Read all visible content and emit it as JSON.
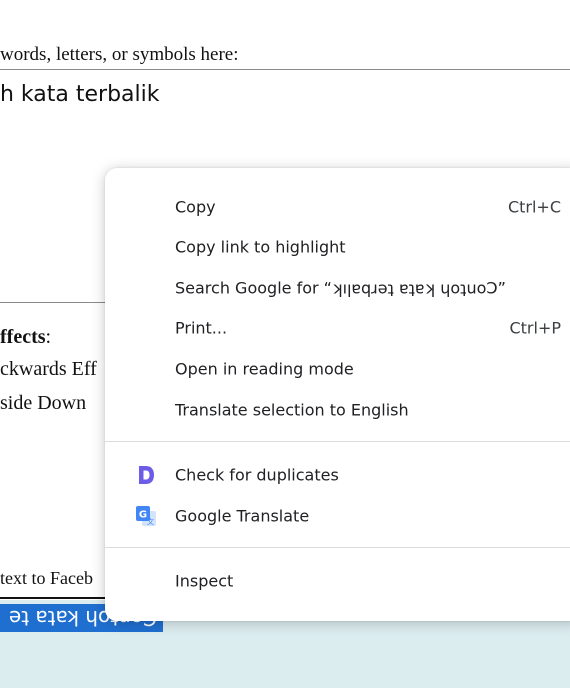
{
  "page": {
    "prompt": "words, letters, or symbols here:",
    "textarea_value": "h kata terbalik",
    "effects_title": "ffects",
    "effects_colon": ":",
    "effects": [
      "ckwards Eff",
      "side Down "
    ],
    "facebook_text": "text to Faceb",
    "selected_output": "Contoh kata te"
  },
  "context_menu": {
    "copy": {
      "label": "Copy",
      "shortcut": "Ctrl+C"
    },
    "copy_link": {
      "label": "Copy link to highlight"
    },
    "search": {
      "label": "Search Google for “ʞıןɐqɹǝʇ ɐʇɐʞ ɥoʇuoƆ”"
    },
    "print": {
      "label": "Print...",
      "shortcut": "Ctrl+P"
    },
    "reading_mode": {
      "label": "Open in reading mode"
    },
    "translate_selection": {
      "label": "Translate selection to English"
    },
    "check_duplicates": {
      "label": "Check for duplicates",
      "icon": "dupe-checker-d-icon"
    },
    "google_translate": {
      "label": "Google Translate",
      "icon": "google-translate-icon"
    },
    "inspect": {
      "label": "Inspect"
    }
  },
  "colors": {
    "selection": "#1f6fd1",
    "output_bg": "#dcedf0",
    "dupe_icon": "#6c5ce7",
    "translate_icon": "#4285f4"
  }
}
